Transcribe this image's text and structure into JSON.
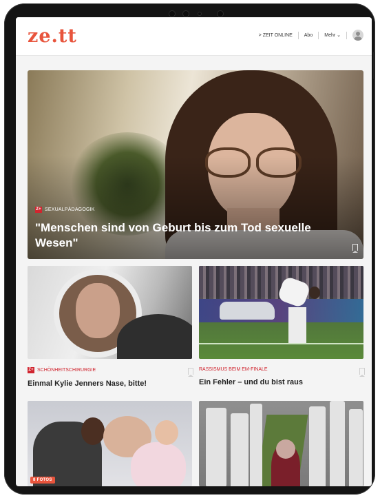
{
  "header": {
    "logo": "ze.tt",
    "nav": [
      "> ZEIT ONLINE",
      "Abo",
      "Mehr ⌄"
    ]
  },
  "hero": {
    "kicker": "SEXUALPÄDAGOGIK",
    "title": "\"Menschen sind von Geburt bis zum Tod sexuelle Wesen\""
  },
  "cards": [
    {
      "kicker": "SCHÖNHEITSCHIRURGIE",
      "title": "Einmal Kylie Jenners Nase, bitte!",
      "zplus": true
    },
    {
      "kicker": "RASSISMUS BEIM EM-FINALE",
      "title": "Ein Fehler – und du bist raus",
      "zplus": false
    }
  ],
  "gallery_badge": "8 FOTOS",
  "badge_label": "Z+",
  "colors": {
    "accent": "#e8543c",
    "kicker_red": "#d0252f"
  }
}
